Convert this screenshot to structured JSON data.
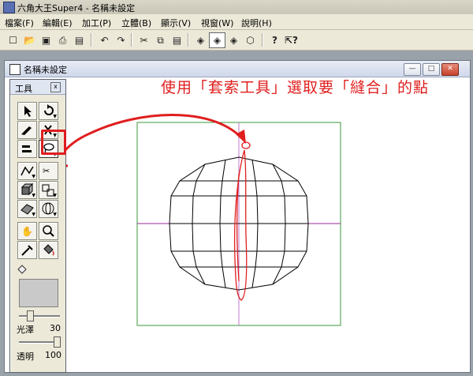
{
  "window": {
    "title": "六角大王Super4 - 名稱未設定"
  },
  "menu": [
    "檔案(F)",
    "編輯(E)",
    "加工(P)",
    "立體(B)",
    "顯示(V)",
    "視窗(W)",
    "說明(H)"
  ],
  "toolbar_icons": [
    "new-icon",
    "open-icon",
    "save-icon",
    "print-icon",
    "print-preview-icon",
    "undo-icon",
    "redo-icon",
    "cut-icon",
    "copy-icon",
    "paste-icon",
    "view-front-icon",
    "view-rotate-icon",
    "view-top-icon",
    "view-cube-icon",
    "help-icon",
    "context-help-icon"
  ],
  "document": {
    "title": "名稱未設定"
  },
  "tool_panel": {
    "title": "工具",
    "gloss_label": "光澤",
    "gloss_value": "30",
    "opacity_label": "透明",
    "opacity_value": "100"
  },
  "annotation": {
    "text": "使用「套索工具」選取要「縫合」的點",
    "color": "#e01e1e"
  },
  "colors": {
    "grid_frame": "#3a9a3a",
    "axis_horizontal": "#9a2c9a",
    "axis_vertical": "#c07bd0",
    "lasso": "#e01e1e",
    "mdi_background": "#9aa2a9"
  }
}
